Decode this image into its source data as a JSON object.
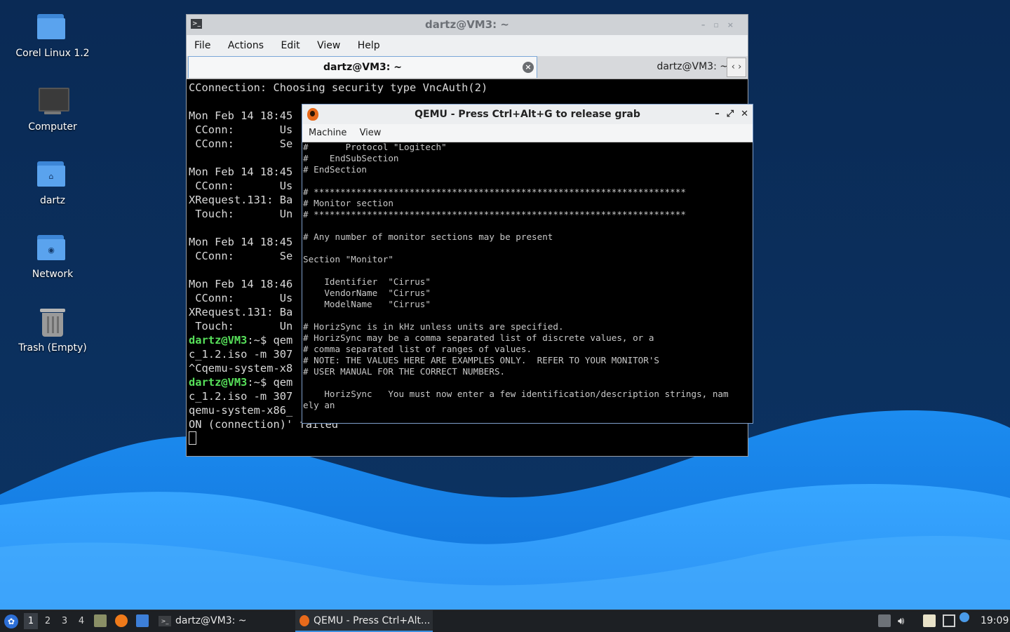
{
  "desktop": {
    "icons": [
      {
        "label": "Corel Linux 1.2",
        "icon": "folder-icon"
      },
      {
        "label": "Computer",
        "icon": "computer-icon"
      },
      {
        "label": "dartz",
        "icon": "home-folder-icon"
      },
      {
        "label": "Network",
        "icon": "network-folder-icon"
      },
      {
        "label": "Trash (Empty)",
        "icon": "trash-icon"
      }
    ]
  },
  "terminal": {
    "title": "dartz@VM3: ~",
    "menu": [
      "File",
      "Actions",
      "Edit",
      "View",
      "Help"
    ],
    "tabs": [
      {
        "label": "dartz@VM3: ~",
        "active": true
      },
      {
        "label": "dartz@VM3: ~",
        "active": false
      }
    ],
    "lines": [
      {
        "text": "CConnection: Choosing security type VncAuth(2)"
      },
      {
        "text": ""
      },
      {
        "text": "Mon Feb 14 18:45"
      },
      {
        "text": " CConn:       Us"
      },
      {
        "text": " CConn:       Se"
      },
      {
        "text": ""
      },
      {
        "text": "Mon Feb 14 18:45"
      },
      {
        "text": " CConn:       Us"
      },
      {
        "text": "XRequest.131: Ba"
      },
      {
        "text": " Touch:       Un"
      },
      {
        "text": ""
      },
      {
        "text": "Mon Feb 14 18:45"
      },
      {
        "text": " CConn:       Se"
      },
      {
        "text": ""
      },
      {
        "text": "Mon Feb 14 18:46"
      },
      {
        "text": " CConn:       Us"
      },
      {
        "text": "XRequest.131: Ba"
      },
      {
        "text": " Touch:       Un"
      },
      {
        "prompt": "dartz@VM3",
        "text": ":~$ qem"
      },
      {
        "text": "c_1.2.iso -m 307"
      },
      {
        "text": "^Cqemu-system-x8"
      },
      {
        "prompt": "dartz@VM3",
        "text": ":~$ qem"
      },
      {
        "text": "c_1.2.iso -m 307"
      },
      {
        "text": "qemu-system-x86_"
      },
      {
        "text": "ON (connection)' failed"
      }
    ]
  },
  "qemu": {
    "title": "QEMU - Press Ctrl+Alt+G to release grab",
    "menu": [
      "Machine",
      "View"
    ],
    "lines": [
      "#       Protocol \"Logitech\"",
      "#    EndSubSection",
      "# EndSection",
      "",
      "# **********************************************************************",
      "# Monitor section",
      "# **********************************************************************",
      "",
      "# Any number of monitor sections may be present",
      "",
      "Section \"Monitor\"",
      "",
      "    Identifier  \"Cirrus\"",
      "    VendorName  \"Cirrus\"",
      "    ModelName   \"Cirrus\"",
      "",
      "# HorizSync is in kHz unless units are specified.",
      "# HorizSync may be a comma separated list of discrete values, or a",
      "# comma separated list of ranges of values.",
      "# NOTE: THE VALUES HERE ARE EXAMPLES ONLY.  REFER TO YOUR MONITOR'S",
      "# USER MANUAL FOR THE CORRECT NUMBERS.",
      "",
      "    HorizSync   You must now enter a few identification/description strings, nam",
      "ely an"
    ]
  },
  "taskbar": {
    "workspaces": [
      "1",
      "2",
      "3",
      "4"
    ],
    "active_workspace": "1",
    "tasks": [
      {
        "label": "dartz@VM3: ~",
        "icon": "terminal-icon",
        "active": false
      },
      {
        "label": "QEMU - Press Ctrl+Alt...",
        "icon": "qemu-icon",
        "active": true
      }
    ],
    "clock": "19:09"
  }
}
